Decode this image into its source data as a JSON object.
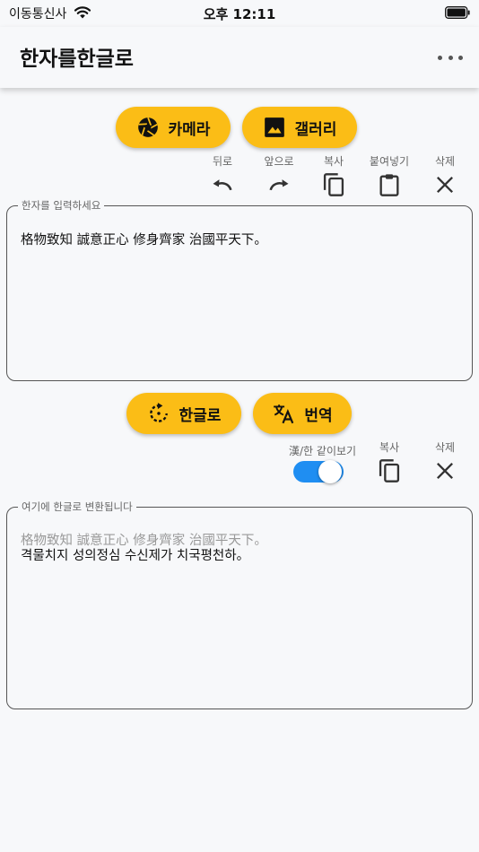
{
  "status": {
    "carrier": "이동통신사",
    "time": "오후 12:11"
  },
  "appbar": {
    "title": "한자를한글로"
  },
  "top_buttons": {
    "camera": "카메라",
    "gallery": "갤러리"
  },
  "input_tools": {
    "undo": "뒤로",
    "redo": "앞으로",
    "copy": "복사",
    "paste": "붙여넣기",
    "delete": "삭제"
  },
  "input_field": {
    "legend": "한자를 입력하세요",
    "value": "格物致知 誠意正心 修身齊家 治國平天下。"
  },
  "middle_buttons": {
    "to_hangul": "한글로",
    "translate": "번역"
  },
  "output_tools": {
    "toggle_label": "漢/한 같이보기",
    "toggle_on": true,
    "copy": "복사",
    "delete": "삭제"
  },
  "output_field": {
    "legend": "여기에 한글로 변환됩니다",
    "hanja_line": "格物致知 誠意正心 修身齊家 治國平天下。",
    "hangul_line": "격물치지 성의정심 수신제가 치국평천하。"
  },
  "colors": {
    "accent": "#fbbd16",
    "toggle": "#1f8ef2"
  }
}
